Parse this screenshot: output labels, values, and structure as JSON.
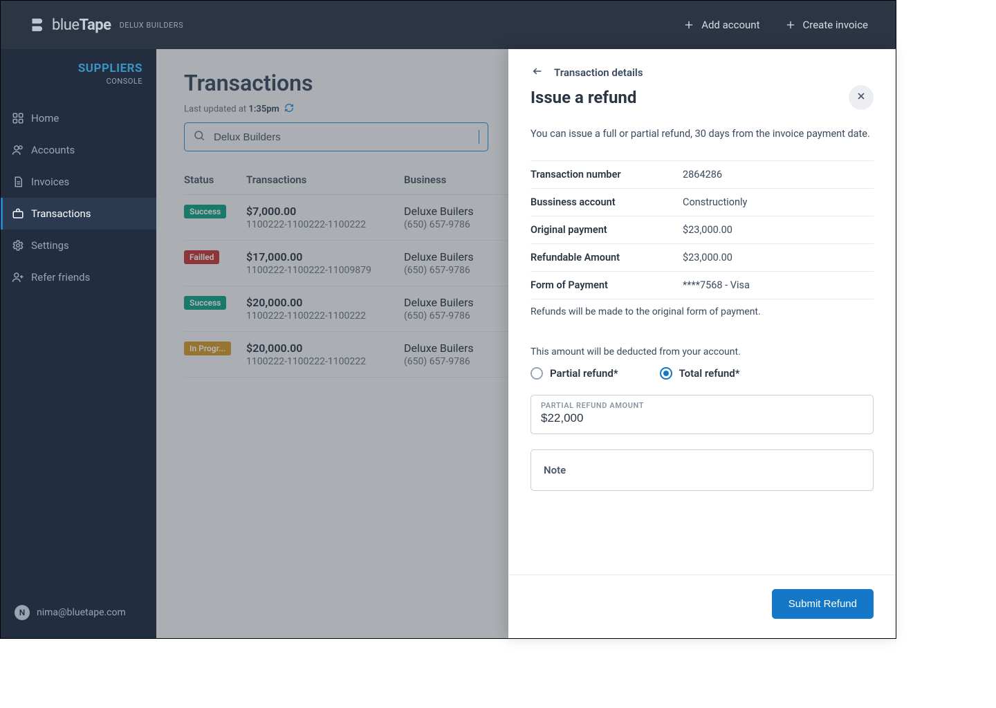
{
  "header": {
    "brand": "blueTape",
    "org": "DELUX BUILDERS",
    "add_account": "Add account",
    "create_invoice": "Create invoice"
  },
  "sidebar": {
    "title": "SUPPLIERS",
    "subtitle": "CONSOLE",
    "items": [
      {
        "label": "Home"
      },
      {
        "label": "Accounts"
      },
      {
        "label": "Invoices"
      },
      {
        "label": "Transactions"
      },
      {
        "label": "Settings"
      },
      {
        "label": "Refer friends"
      }
    ],
    "user_initial": "N",
    "user_email": "nima@bluetape.com"
  },
  "main": {
    "title": "Transactions",
    "last_updated_prefix": "Last updated at ",
    "last_updated_time": "1:35pm",
    "search_value": "Delux Builders",
    "columns": {
      "status": "Status",
      "transactions": "Transactions",
      "business": "Business"
    },
    "rows": [
      {
        "status": "Success",
        "status_class": "success",
        "amount": "$7,000.00",
        "ref": "1100222-1100222-1100222",
        "business_name": "Deluxe Builers",
        "business_phone": "(650) 657-9786"
      },
      {
        "status": "Failled",
        "status_class": "failed",
        "amount": "$17,000.00",
        "ref": "1100222-1100222-11009879",
        "business_name": "Deluxe Builers",
        "business_phone": "(650) 657-9786"
      },
      {
        "status": "Success",
        "status_class": "success",
        "amount": "$20,000.00",
        "ref": "1100222-1100222-1100222",
        "business_name": "Deluxe Builers",
        "business_phone": "(650) 657-9786"
      },
      {
        "status": "In Progr...",
        "status_class": "progress",
        "amount": "$20,000.00",
        "ref": "1100222-1100222-1100222",
        "business_name": "Deluxe Builers",
        "business_phone": "(650) 657-9786"
      }
    ]
  },
  "drawer": {
    "back_label": "Transaction details",
    "title": "Issue a refund",
    "description": "You can issue a full or partial refund, 30 days from the invoice payment date.",
    "details": [
      {
        "label": "Transaction number",
        "value": "2864286"
      },
      {
        "label": "Bussiness account",
        "value": "Constructionly"
      },
      {
        "label": "Original payment",
        "value": "$23,000.00"
      },
      {
        "label": "Refundable Amount",
        "value": "$23,000.00"
      },
      {
        "label": "Form of Payment",
        "value": "****7568 - Visa"
      }
    ],
    "refund_note": "Refunds will be made to the original form of payment.",
    "deduct_note": "This amount will be deducted from your account.",
    "partial_label": "Partial refund*",
    "total_label": "Total refund*",
    "amount_label": "PARTIAL REFUND AMOUNT",
    "amount_value": "$22,000",
    "note_placeholder": "Note",
    "submit": "Submit Refund"
  }
}
